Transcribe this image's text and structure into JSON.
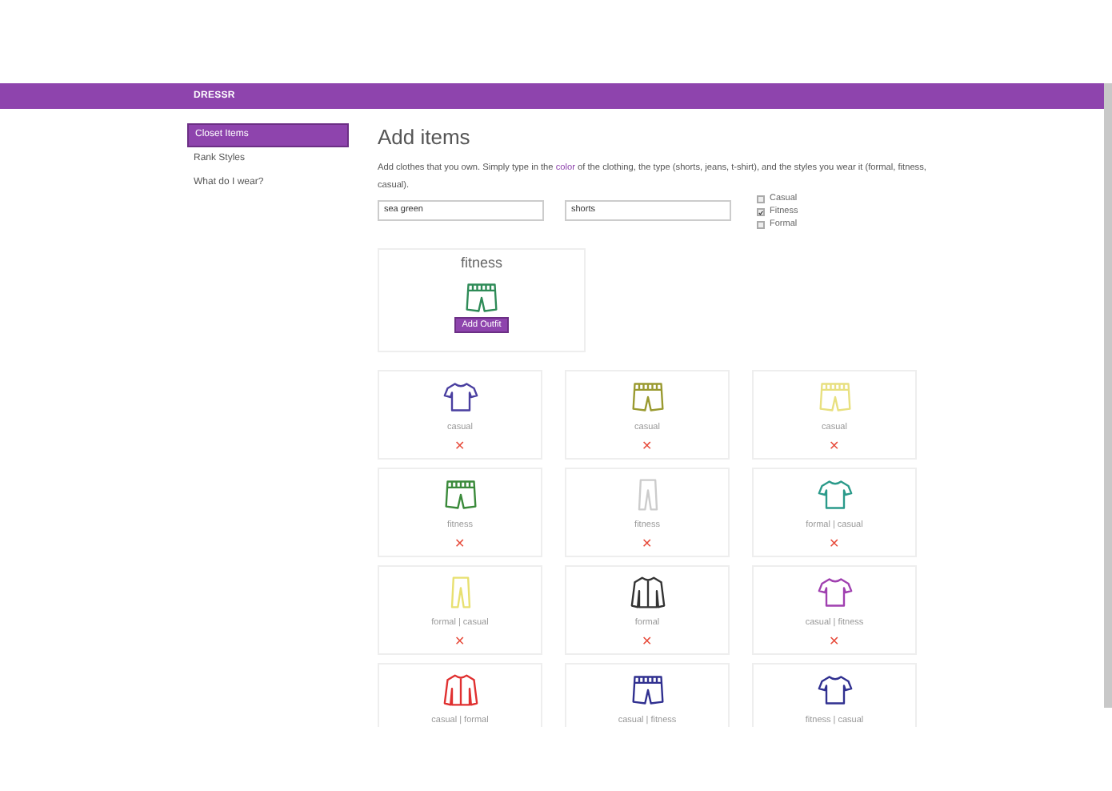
{
  "navbar": {
    "brand": "DRESSR"
  },
  "sidebar": {
    "items": [
      {
        "label": "Closet Items",
        "selected": true
      },
      {
        "label": "Rank Styles",
        "selected": false
      },
      {
        "label": "What do I wear?",
        "selected": false
      }
    ]
  },
  "heading": "Add items",
  "description": {
    "before": "Add clothes that you own. Simply type in the",
    "link": "color",
    "after": "of the clothing, the type (shorts, jeans, t-shirt), and the styles you wear it (formal, fitness, casual)."
  },
  "form": {
    "color_value": "sea green",
    "type_value": "shorts",
    "styles": [
      {
        "label": "Casual",
        "checked": false
      },
      {
        "label": "Fitness",
        "checked": true
      },
      {
        "label": "Formal",
        "checked": false
      }
    ]
  },
  "preview": {
    "styles": "fitness",
    "kind": "shorts",
    "color": "#2e8b57",
    "button": "Add Outfit"
  },
  "items": [
    {
      "kind": "shirt",
      "color": "#4a3fa0",
      "styles": "casual",
      "remove": "✕"
    },
    {
      "kind": "shorts",
      "color": "#9a9a30",
      "styles": "casual",
      "remove": "✕"
    },
    {
      "kind": "shorts",
      "color": "#e8e080",
      "styles": "casual",
      "remove": "✕"
    },
    {
      "kind": "shorts",
      "color": "#3a8a3a",
      "styles": "fitness",
      "remove": "✕"
    },
    {
      "kind": "pants",
      "color": "#cccccc",
      "styles": "fitness",
      "remove": "✕"
    },
    {
      "kind": "shirt",
      "color": "#2a9a8a",
      "styles": "formal | casual",
      "remove": "✕"
    },
    {
      "kind": "pants",
      "color": "#e8e070",
      "styles": "formal | casual",
      "remove": "✕"
    },
    {
      "kind": "jacket",
      "color": "#333333",
      "styles": "formal",
      "remove": "✕"
    },
    {
      "kind": "shirt",
      "color": "#a040b0",
      "styles": "casual | fitness",
      "remove": "✕"
    },
    {
      "kind": "jacket",
      "color": "#e03030",
      "styles": "casual | formal"
    },
    {
      "kind": "shorts",
      "color": "#303090",
      "styles": "casual | fitness"
    },
    {
      "kind": "shirt",
      "color": "#303090",
      "styles": "fitness | casual"
    }
  ]
}
